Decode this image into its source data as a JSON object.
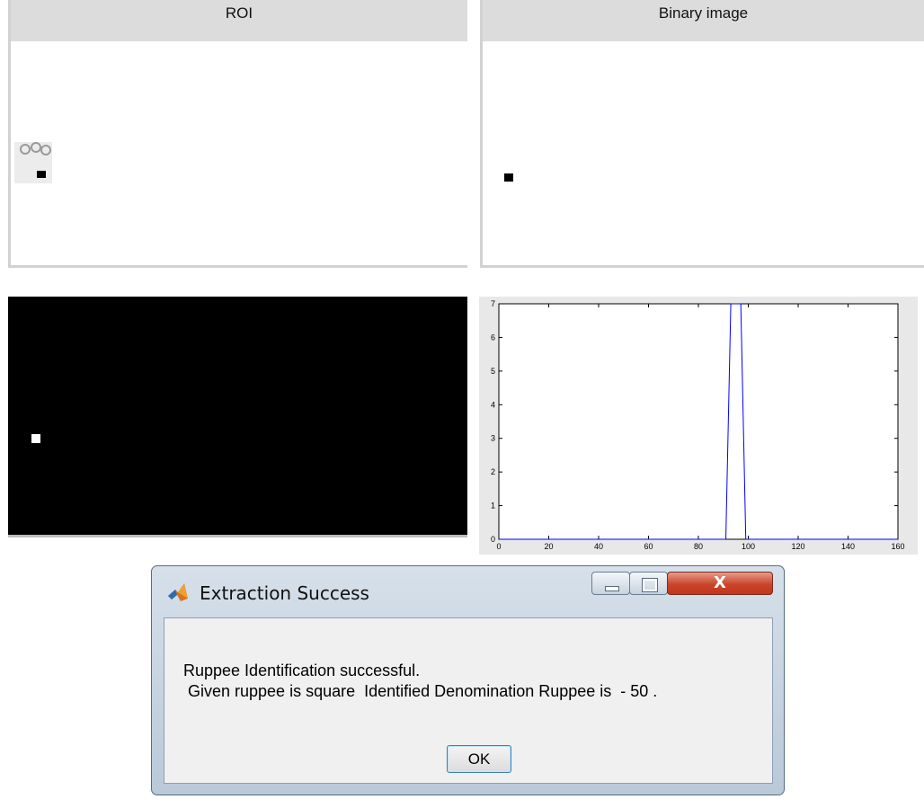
{
  "panels": {
    "roi": {
      "title": "ROI"
    },
    "binary": {
      "title": "Binary image"
    }
  },
  "chart_data": {
    "type": "line",
    "title": "",
    "xlabel": "",
    "ylabel": "",
    "xlim": [
      0,
      160
    ],
    "ylim": [
      0,
      7
    ],
    "xticks": [
      0,
      20,
      40,
      60,
      80,
      100,
      120,
      140,
      160
    ],
    "yticks": [
      0,
      1,
      2,
      3,
      4,
      5,
      6,
      7
    ],
    "grid": false,
    "series": [
      {
        "color": "#0000ff",
        "x": [
          0,
          91,
          93,
          97,
          99,
          160
        ],
        "y": [
          0,
          0,
          7,
          7,
          0,
          0
        ]
      }
    ]
  },
  "dialog": {
    "title": "Extraction Success",
    "message_line1": "Ruppee Identification successful.",
    "message_line2": " Given ruppee is square  Identified Denomination Ruppee is  - 50 .",
    "ok_label": "OK",
    "close_glyph": "X",
    "icon": "matlab-icon"
  }
}
